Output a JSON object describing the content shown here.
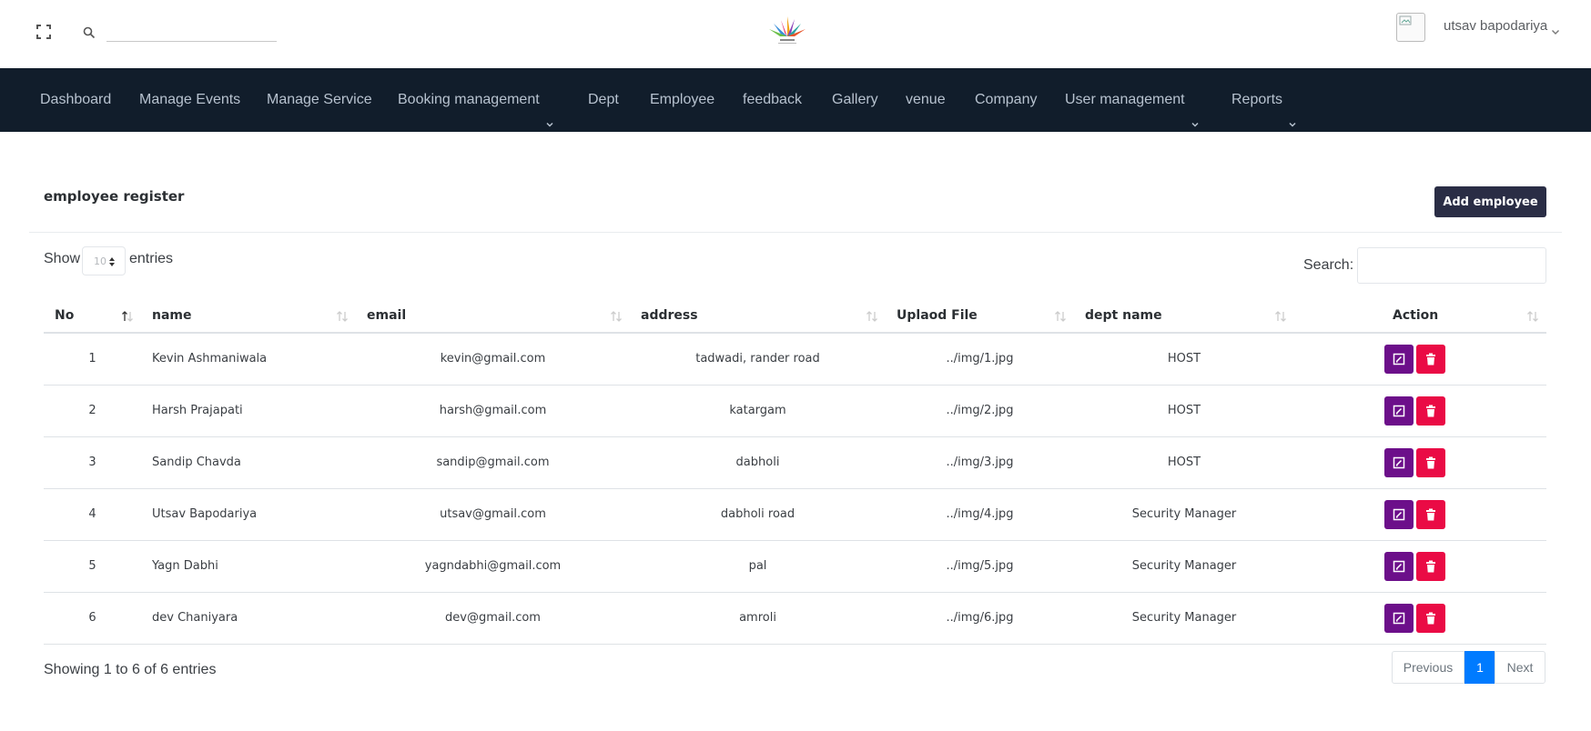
{
  "header": {
    "search_placeholder": "",
    "user_name": "utsav bapodariya"
  },
  "nav": {
    "items": [
      {
        "label": "Dashboard",
        "dropdown": false
      },
      {
        "label": "Manage Events",
        "dropdown": false
      },
      {
        "label": "Manage Service",
        "dropdown": false
      },
      {
        "label": "Booking management",
        "dropdown": true
      },
      {
        "label": "Dept",
        "dropdown": false
      },
      {
        "label": "Employee",
        "dropdown": false
      },
      {
        "label": "feedback",
        "dropdown": false
      },
      {
        "label": "Gallery",
        "dropdown": false
      },
      {
        "label": "venue",
        "dropdown": false
      },
      {
        "label": "Company",
        "dropdown": false
      },
      {
        "label": "User management",
        "dropdown": true
      },
      {
        "label": "Reports",
        "dropdown": true
      }
    ]
  },
  "card": {
    "title": "employee register",
    "add_button": "Add employee"
  },
  "table_controls": {
    "show_label": "Show",
    "entries_value": "10",
    "entries_label": "entries",
    "search_label": "Search:",
    "search_value": ""
  },
  "table": {
    "columns": [
      "No",
      "name",
      "email",
      "address",
      "Uplaod File",
      "dept name",
      "Action"
    ],
    "rows": [
      {
        "no": "1",
        "name": "Kevin Ashmaniwala",
        "email": "kevin@gmail.com",
        "address": "tadwadi, rander road",
        "file": "../img/1.jpg",
        "dept": "HOST"
      },
      {
        "no": "2",
        "name": "Harsh Prajapati",
        "email": "harsh@gmail.com",
        "address": "katargam",
        "file": "../img/2.jpg",
        "dept": "HOST"
      },
      {
        "no": "3",
        "name": "Sandip Chavda",
        "email": "sandip@gmail.com",
        "address": "dabholi",
        "file": "../img/3.jpg",
        "dept": "HOST"
      },
      {
        "no": "4",
        "name": "Utsav Bapodariya",
        "email": "utsav@gmail.com",
        "address": "dabholi road",
        "file": "../img/4.jpg",
        "dept": "Security Manager"
      },
      {
        "no": "5",
        "name": "Yagn Dabhi",
        "email": "yagndabhi@gmail.com",
        "address": "pal",
        "file": "../img/5.jpg",
        "dept": "Security Manager"
      },
      {
        "no": "6",
        "name": "dev Chaniyara",
        "email": "dev@gmail.com",
        "address": "amroli",
        "file": "../img/6.jpg",
        "dept": "Security Manager"
      }
    ]
  },
  "footer": {
    "info": "Showing 1 to 6 of 6 entries",
    "previous": "Previous",
    "current_page": "1",
    "next": "Next"
  },
  "colors": {
    "nav_bg": "#111d2b",
    "add_button_bg": "#2a2d45",
    "edit_button_bg": "#6c0f8a",
    "delete_button_bg": "#ea0b45",
    "page_active_bg": "#007bff"
  }
}
